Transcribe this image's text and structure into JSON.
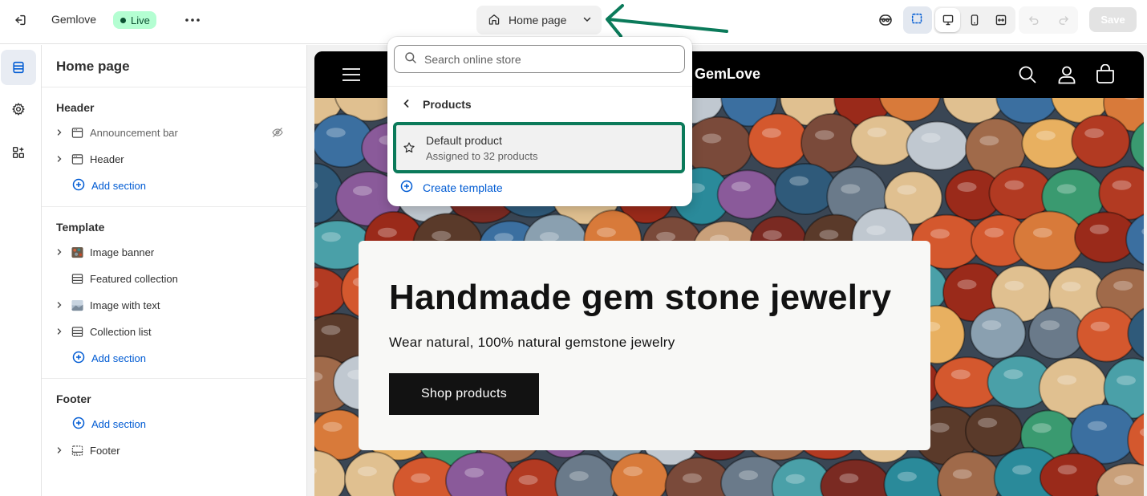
{
  "topbar": {
    "store_name": "Gemlove",
    "status_badge": "Live",
    "page_selector": "Home page",
    "save_label": "Save",
    "annotation_arrow_color": "#0b7a5a"
  },
  "rail": {
    "items": [
      {
        "icon": "sections-icon",
        "active": true
      },
      {
        "icon": "settings-gear-icon",
        "active": false
      },
      {
        "icon": "apps-blocks-icon",
        "active": false
      }
    ]
  },
  "sidebar": {
    "title": "Home page",
    "header_group": {
      "label": "Header",
      "items": [
        {
          "label": "Announcement bar",
          "icon": "layout-icon",
          "hidden": true
        },
        {
          "label": "Header",
          "icon": "layout-icon"
        }
      ],
      "add_label": "Add section"
    },
    "template_group": {
      "label": "Template",
      "items": [
        {
          "label": "Image banner",
          "icon": "image-thumb-icon"
        },
        {
          "label": "Featured collection",
          "icon": "layout-icon"
        },
        {
          "label": "Image with text",
          "icon": "image-thumb-icon"
        },
        {
          "label": "Collection list",
          "icon": "layout-icon"
        }
      ],
      "add_label": "Add section"
    },
    "footer_group": {
      "label": "Footer",
      "add_label": "Add section",
      "items": [
        {
          "label": "Footer",
          "icon": "footer-layout-icon"
        }
      ]
    }
  },
  "preview": {
    "logo": "GemLove",
    "hero_title": "Handmade gem stone jewelry",
    "hero_subtitle": "Wear natural, 100% natural gemstone jewelry",
    "hero_button": "Shop products"
  },
  "popover": {
    "search_placeholder": "Search online store",
    "back_label": "Products",
    "item_title": "Default product",
    "item_subtitle": "Assigned to 32 products",
    "create_label": "Create template",
    "highlight_color": "#0b7a5a"
  }
}
